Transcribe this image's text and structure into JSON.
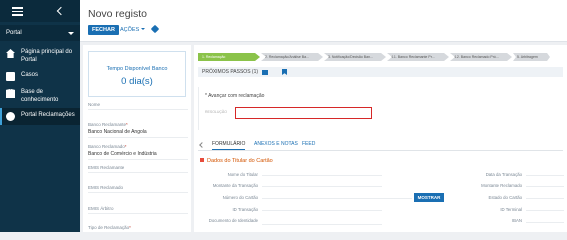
{
  "sidebar": {
    "portal_label": "Portal",
    "items": [
      {
        "label": "Página principal do Portal"
      },
      {
        "label": "Casos"
      },
      {
        "label": "Base de conhecimento"
      },
      {
        "label": "Portal Reclamações"
      }
    ]
  },
  "header": {
    "title": "Novo registo",
    "save_label": "FECHAR",
    "actions_label": "AÇÕES"
  },
  "info": {
    "timer_label": "Tempo Disponível Banco",
    "timer_value": "0 dia(s)",
    "nome_label": "Nome",
    "banco_reclamante_label": "Banco Reclamante",
    "banco_reclamante_value": "Banco Nacional de Angola",
    "banco_reclamado_label": "Banco Reclamado",
    "banco_reclamado_value": "Banco de Comércio e Indústria",
    "emis_reclamante_label": "EMIS Reclamante",
    "emis_reclamado_label": "EMIS Reclamado",
    "emis_arbitro_label": "EMIS Árbitro",
    "tipo_reclamacao_label": "Tipo de Reclamação"
  },
  "main": {
    "path_steps": [
      "1. Reclamação",
      "2. Reclamação/Análise Ba...",
      "3. Notificação/Decisão Ban...",
      "4.1. Banco Reclamante Pr...",
      "4.2. Banco Reclamado Pró...",
      "5. Arbitragem"
    ],
    "next_steps_label": "PRÓXIMOS PASSOS (1)",
    "task_text": "Avançar com reclamação",
    "task_sub": "RESOLUÇÃO",
    "tabs": [
      "FORMULÁRIO",
      "ANEXOS E NOTAS",
      "FEED"
    ],
    "section_title": "Dados do Titular do Cartão",
    "fields_left": [
      "Nome do Titular",
      "Montante da Transação",
      "Número do Cartão",
      "ID Transação",
      "Documento de Identidade"
    ],
    "fields_right": [
      "Data da Transação",
      "Montante Reclamado",
      "Estado do Cartão",
      "ID Terminal",
      "IBAN"
    ],
    "mostrar_label": "MOSTRAR"
  }
}
